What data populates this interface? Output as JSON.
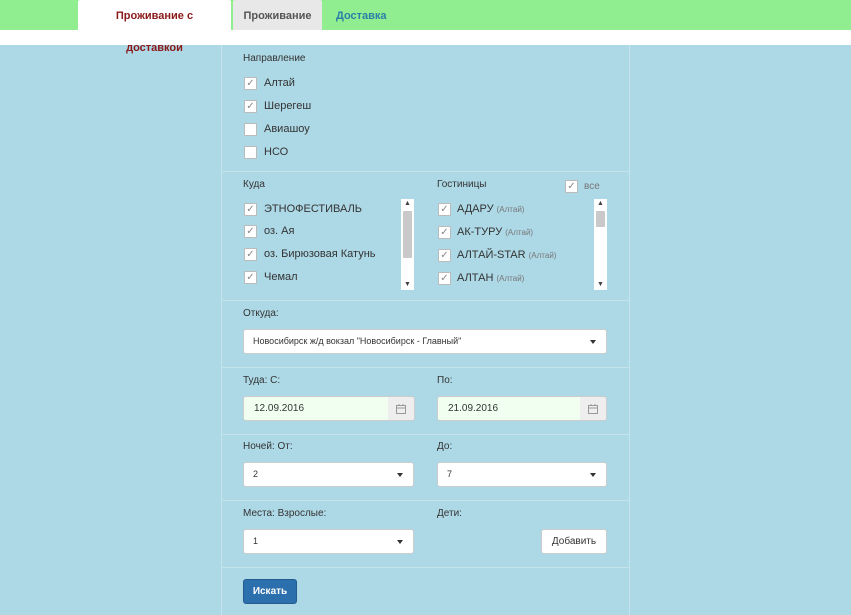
{
  "tabs": [
    {
      "label": "Проживание с доставкой",
      "active": true
    },
    {
      "label": "Проживание",
      "active": false
    },
    {
      "label": "Доставка",
      "active": false
    }
  ],
  "direction": {
    "label": "Направление",
    "items": [
      {
        "label": "Алтай",
        "checked": true
      },
      {
        "label": "Шерегеш",
        "checked": true
      },
      {
        "label": "Авиашоу",
        "checked": false
      },
      {
        "label": "НСО",
        "checked": false
      }
    ]
  },
  "destinations": {
    "label": "Куда",
    "items": [
      {
        "label": "ЭТНОФЕСТИВАЛЬ",
        "checked": true
      },
      {
        "label": "оз. Ая",
        "checked": true
      },
      {
        "label": "оз. Бирюзовая Катунь",
        "checked": true
      },
      {
        "label": "Чемал",
        "checked": true
      }
    ]
  },
  "hotels": {
    "label": "Гостиницы",
    "all_label": "все",
    "all_checked": true,
    "items": [
      {
        "label": "АДАРУ",
        "region": "(Алтай)",
        "checked": true
      },
      {
        "label": "АК-ТУРУ",
        "region": "(Алтай)",
        "checked": true
      },
      {
        "label": "АЛТАЙ-STAR",
        "region": "(Алтай)",
        "checked": true
      },
      {
        "label": "АЛТАН",
        "region": "(Алтай)",
        "checked": true
      }
    ]
  },
  "from": {
    "label": "Откуда:",
    "value": "Новосибирск ж/д вокзал \"Новосибирск - Главный\""
  },
  "dates": {
    "from_label": "Туда: С:",
    "from_value": "12.09.2016",
    "to_label": "По:",
    "to_value": "21.09.2016"
  },
  "nights": {
    "from_label": "Ночей: От:",
    "from_value": "2",
    "to_label": "До:",
    "to_value": "7"
  },
  "places": {
    "adults_label": "Места: Взрослые:",
    "adults_value": "1",
    "children_label": "Дети:",
    "add_button": "Добавить"
  },
  "search_button": "Искать",
  "colors": {
    "page_bg": "#add8e6",
    "topbar_bg": "#90ee90",
    "active_tab_text": "#8b1a1a",
    "primary_button": "#2c6fad",
    "date_bg": "#f0fff0"
  }
}
